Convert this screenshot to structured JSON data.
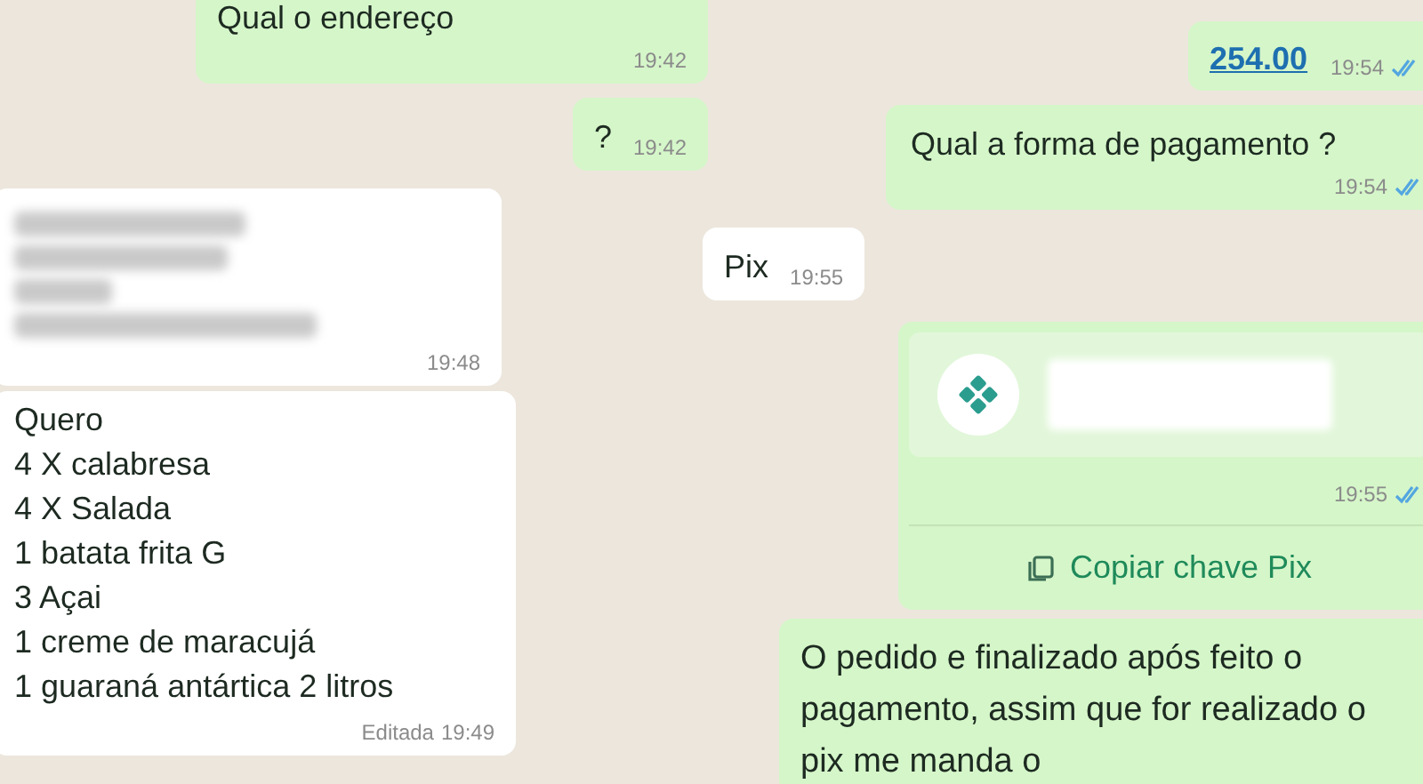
{
  "panels": [
    {
      "messages": [
        {
          "kind": "text",
          "outgoing": true,
          "text": "Qual o endereço",
          "time": "19:42"
        },
        {
          "kind": "text",
          "outgoing": true,
          "text": "?",
          "time": "19:42"
        },
        {
          "kind": "blurred",
          "outgoing": false,
          "time": "19:48"
        },
        {
          "kind": "lines",
          "outgoing": false,
          "lines": [
            "Quero",
            "4 X calabresa",
            "4 X Salada",
            "1 batata frita G",
            "3 Açai",
            "1 creme de maracujá",
            "1 guaraná antártica 2 litros"
          ],
          "edited_label": "Editada",
          "time": "19:49"
        }
      ]
    },
    {
      "messages": [
        {
          "kind": "link",
          "outgoing": true,
          "text": "254.00",
          "time": "19:54",
          "read": true
        },
        {
          "kind": "text",
          "outgoing": true,
          "text": "Qual a forma de pagamento ?",
          "time": "19:54",
          "read": true
        },
        {
          "kind": "text",
          "outgoing": false,
          "text": "Pix",
          "time": "19:55"
        },
        {
          "kind": "pix",
          "outgoing": true,
          "time": "19:55",
          "read": true,
          "button": "Copiar chave Pix"
        },
        {
          "kind": "text",
          "outgoing": true,
          "text": "O pedido e finalizado após feito o pagamento, assim que for realizado o pix me manda o"
        }
      ]
    }
  ]
}
